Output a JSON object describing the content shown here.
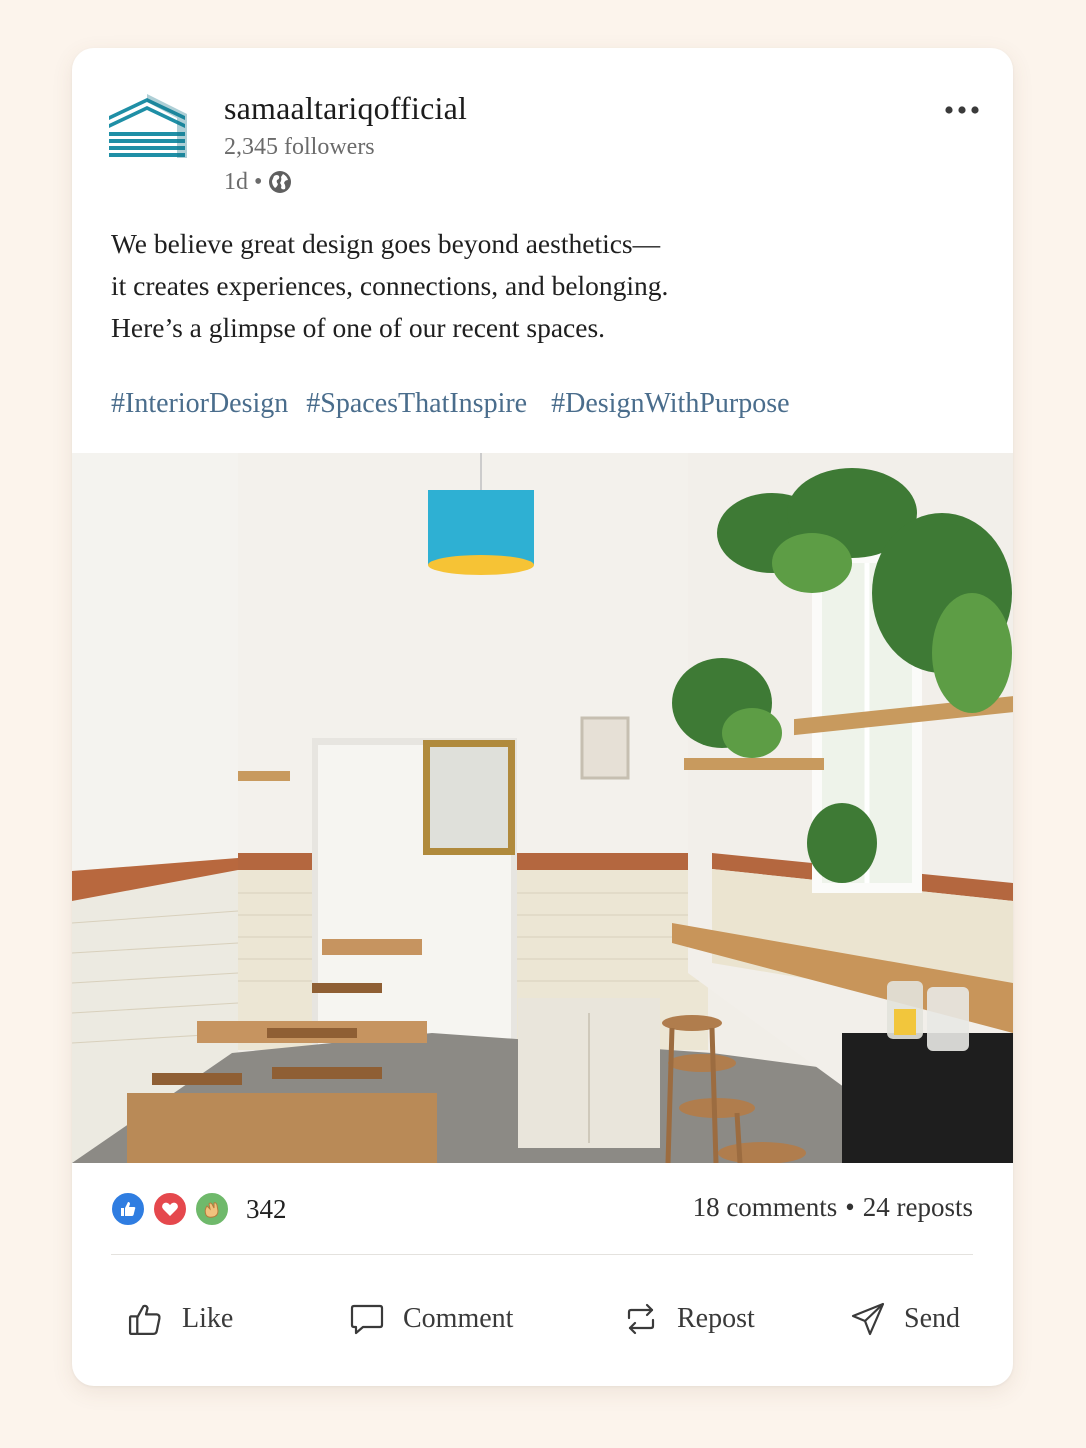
{
  "post": {
    "author": {
      "name": "samaaltariqofficial",
      "followers": "2,345 followers",
      "time": "1d",
      "separator": "•",
      "visibility_icon": "globe-icon",
      "logo_icon": "building-stripes-logo",
      "logo_color": "#1f8fa6"
    },
    "more_icon": "more-horizontal-icon",
    "text_lines": [
      "We believe great design goes beyond aesthetics—",
      "it creates experiences, connections, and belonging.",
      "Here’s a glimpse of one of our recent spaces."
    ],
    "hashtags": [
      "#InteriorDesign",
      "#SpacesThatInspire",
      "#DesignWithPurpose"
    ],
    "hashtag_color": "#4a6d8c",
    "image": {
      "subject": "bright café interior photo"
    },
    "reactions": {
      "icons": [
        "like-reaction-icon",
        "love-reaction-icon",
        "celebrate-reaction-icon"
      ],
      "count": "342"
    },
    "stats": {
      "comments": "18 comments",
      "separator": "•",
      "reposts": "24 reposts"
    },
    "actions": [
      {
        "label": "Like",
        "icon": "thumbs-up-icon"
      },
      {
        "label": "Comment",
        "icon": "comment-icon"
      },
      {
        "label": "Repost",
        "icon": "repost-icon"
      },
      {
        "label": "Send",
        "icon": "send-icon"
      }
    ]
  }
}
